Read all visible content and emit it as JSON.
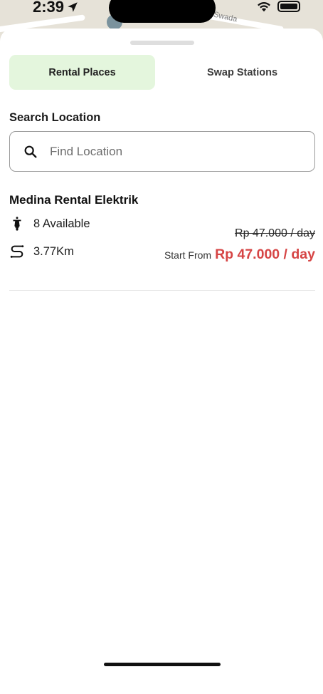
{
  "status_bar": {
    "time": "2:39"
  },
  "map": {
    "street_label": "Swada"
  },
  "tabs": [
    {
      "label": "Rental Places",
      "active": true
    },
    {
      "label": "Swap Stations",
      "active": false
    }
  ],
  "search": {
    "title": "Search Location",
    "placeholder": "Find Location",
    "value": ""
  },
  "rentals": [
    {
      "name": "Medina Rental Elektrik",
      "availability": "8 Available",
      "distance": "3.77Km",
      "original_price": "Rp 47.000 / day",
      "start_from_label": "Start From",
      "price": "Rp 47.000 / day"
    }
  ],
  "colors": {
    "active_tab_bg": "#e4f6dd",
    "price_red": "#d64545",
    "sheet_bg": "#ffffff"
  },
  "icons": {
    "location_arrow": "location-arrow-icon",
    "wifi": "wifi-icon",
    "battery": "battery-icon",
    "search": "search-icon",
    "scooter": "scooter-icon",
    "route": "route-icon"
  }
}
